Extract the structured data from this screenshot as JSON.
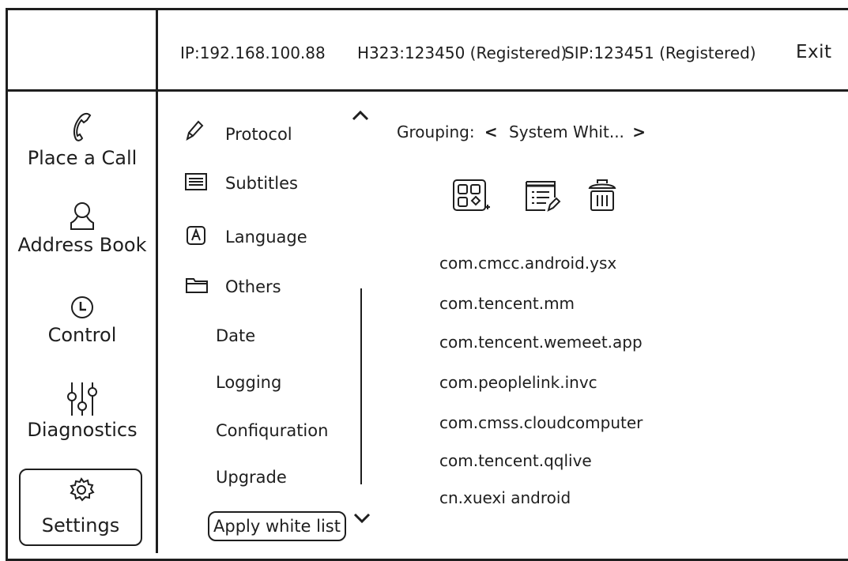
{
  "header": {
    "ip": "IP:192.168.100.88",
    "h323": "H323:123450 (Registered)",
    "sip": "SIP:123451 (Registered)",
    "exit_label": "Exit"
  },
  "nav": {
    "items": [
      {
        "label": "Place a Call",
        "icon": "phone-icon"
      },
      {
        "label": "Address Book",
        "icon": "person-icon"
      },
      {
        "label": "Control",
        "icon": "clock-icon"
      },
      {
        "label": "Diagnostics",
        "icon": "sliders-icon"
      },
      {
        "label": "Settings",
        "icon": "gear-icon",
        "selected": true
      }
    ]
  },
  "menu": {
    "items": [
      {
        "label": "Protocol",
        "icon": "pencil-icon"
      },
      {
        "label": "Subtitles",
        "icon": "list-icon"
      },
      {
        "label": "Language",
        "icon": "letter-a-icon"
      },
      {
        "label": "Others",
        "icon": "folder-icon"
      }
    ],
    "sub_items": [
      "Date",
      "Logging",
      "Confiquration",
      "Upgrade"
    ],
    "apply_label": "Apply white list"
  },
  "panel": {
    "grouping_label": "Grouping:",
    "grouping_value": "System Whit...",
    "packages": [
      "com.cmcc.android.ysx",
      "com.tencent.mm",
      "com.tencent.wemeet.app",
      "com.peoplelink.invc",
      "com.cmss.cloudcomputer",
      "com.tencent.qqlive",
      "cn.xuexi android"
    ]
  }
}
